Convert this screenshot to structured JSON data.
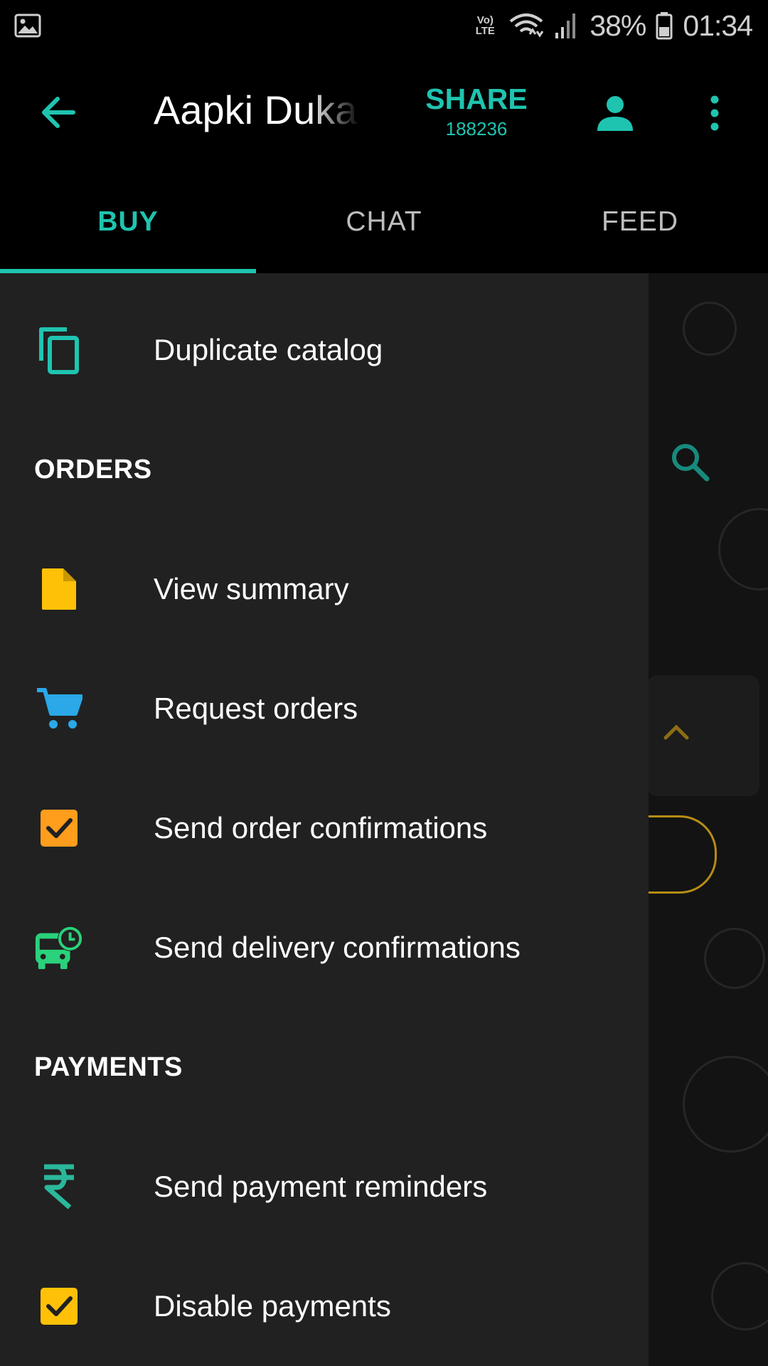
{
  "status_bar": {
    "network_label": "Vo) LTE",
    "battery": "38%",
    "time": "01:34"
  },
  "app_bar": {
    "title": "Aapki Dukaan",
    "share_label": "SHARE",
    "share_count": "188236"
  },
  "tabs": [
    {
      "label": "BUY",
      "active": true
    },
    {
      "label": "CHAT",
      "active": false
    },
    {
      "label": "FEED",
      "active": false
    }
  ],
  "drawer": {
    "top_item": {
      "label": "Duplicate catalog",
      "icon": "copy-icon"
    },
    "orders_header": "ORDERS",
    "orders": [
      {
        "label": "View summary",
        "icon": "document-icon",
        "color": "#ffc107"
      },
      {
        "label": "Request orders",
        "icon": "cart-icon",
        "color": "#2aa8e8"
      },
      {
        "label": "Send order confirmations",
        "icon": "checkbox-icon",
        "color": "#ff9d1c"
      },
      {
        "label": "Send delivery confirmations",
        "icon": "bus-clock-icon",
        "color": "#29d27b"
      }
    ],
    "payments_header": "PAYMENTS",
    "payments": [
      {
        "label": "Send payment reminders",
        "icon": "rupee-icon",
        "color": "#2ab89a"
      },
      {
        "label": "Disable payments",
        "icon": "checkbox-icon",
        "color": "#ffc107"
      }
    ]
  },
  "colors": {
    "accent": "#1fc4b0",
    "drawer_bg": "#212121",
    "app_bg": "#000000"
  }
}
